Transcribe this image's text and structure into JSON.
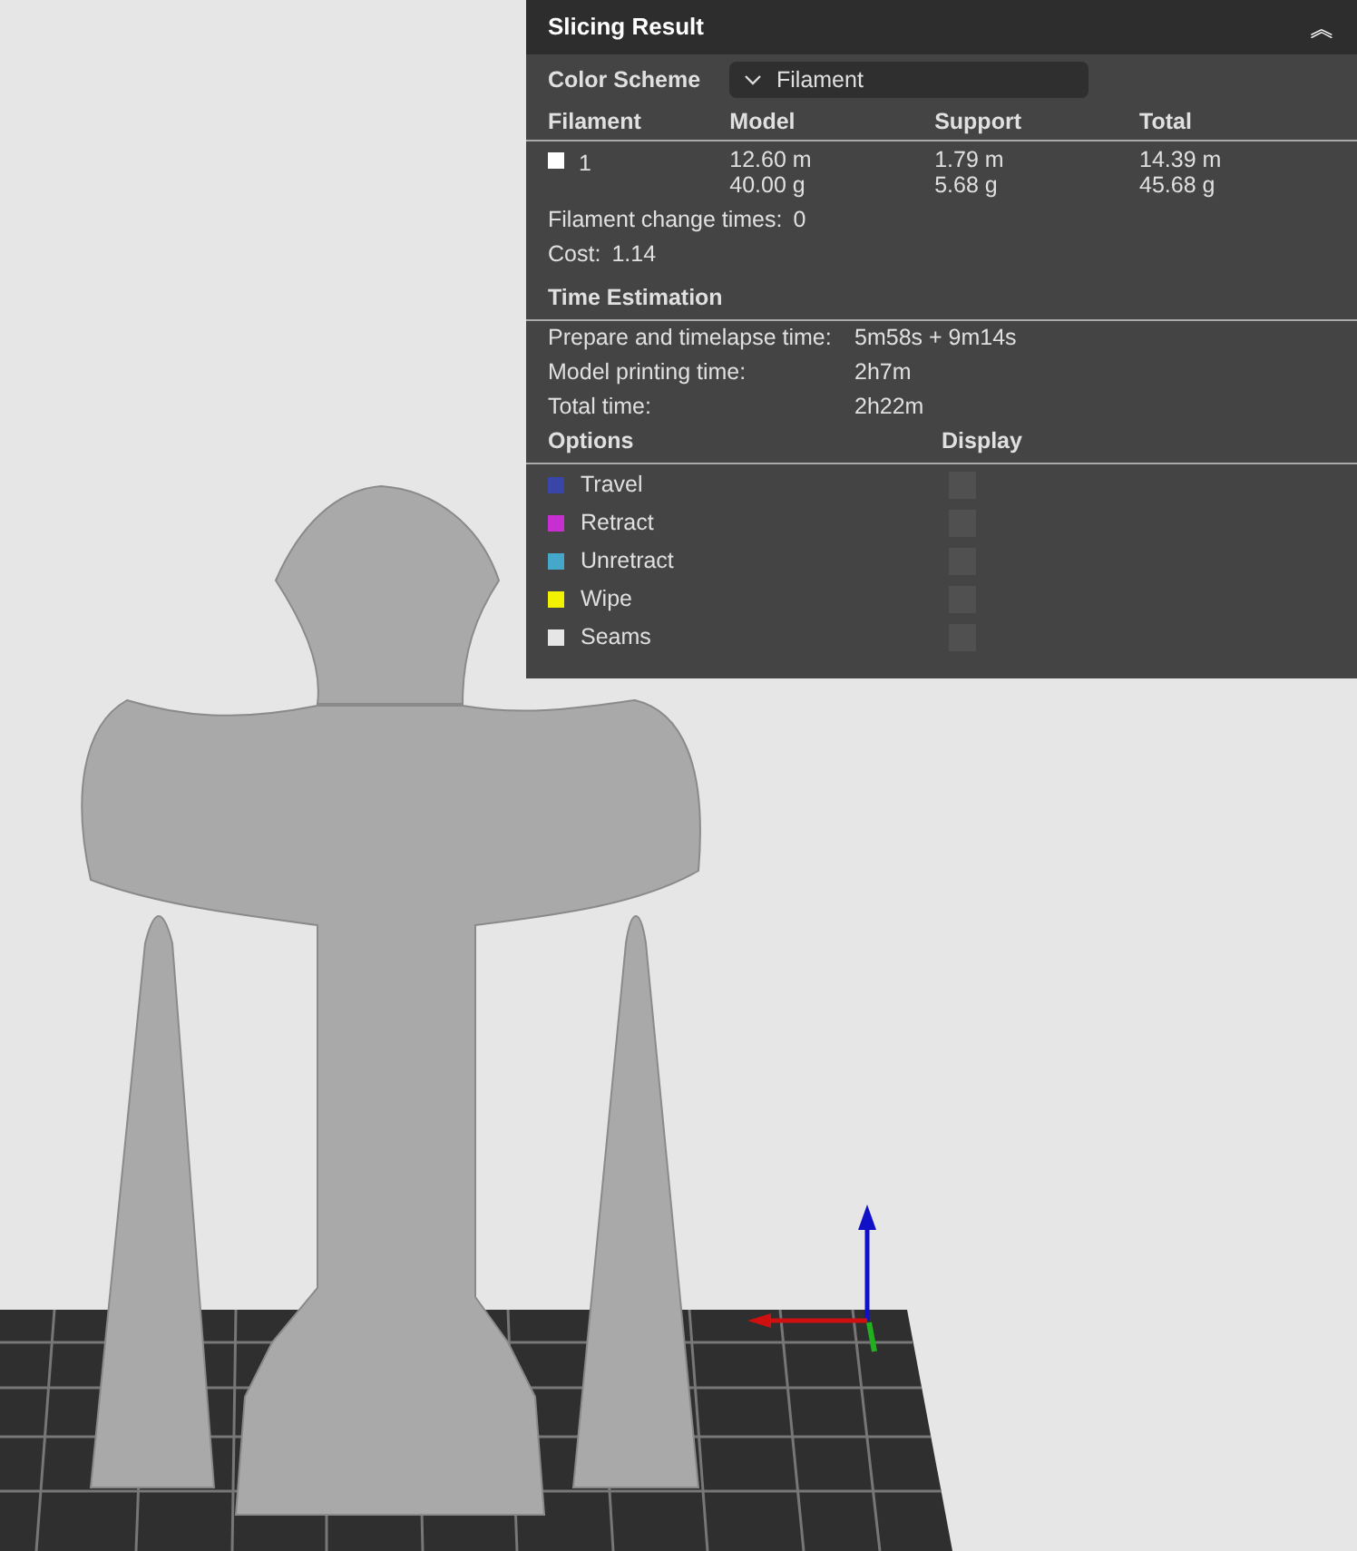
{
  "panel": {
    "title": "Slicing Result",
    "collapse_glyph": "︽",
    "color_scheme": {
      "label": "Color Scheme",
      "value": "Filament"
    },
    "filament_table": {
      "columns": [
        "Filament",
        "Model",
        "Support",
        "Total"
      ],
      "rows": [
        {
          "color": "#ffffff",
          "filament": "1",
          "model": [
            "12.60 m",
            "40.00 g"
          ],
          "support": [
            "1.79 m",
            "5.68 g"
          ],
          "total": [
            "14.39 m",
            "45.68 g"
          ]
        }
      ]
    },
    "stats": [
      {
        "label": "Filament change times:",
        "value": "0"
      },
      {
        "label": "Cost:",
        "value": "1.14"
      }
    ],
    "time_estimation": {
      "title": "Time Estimation",
      "rows": [
        {
          "label": "Prepare and timelapse time:",
          "value": "5m58s + 9m14s"
        },
        {
          "label": "Model printing time:",
          "value": "2h7m"
        },
        {
          "label": "Total time:",
          "value": "2h22m"
        }
      ]
    },
    "options": {
      "columns": [
        "Options",
        "Display"
      ],
      "items": [
        {
          "label": "Travel",
          "color": "#3a45a8",
          "checked": false
        },
        {
          "label": "Retract",
          "color": "#c72fd0",
          "checked": false
        },
        {
          "label": "Unretract",
          "color": "#45a7c9",
          "checked": false
        },
        {
          "label": "Wipe",
          "color": "#f2f200",
          "checked": false
        },
        {
          "label": "Seams",
          "color": "#e6e6e6",
          "checked": false
        }
      ]
    }
  }
}
